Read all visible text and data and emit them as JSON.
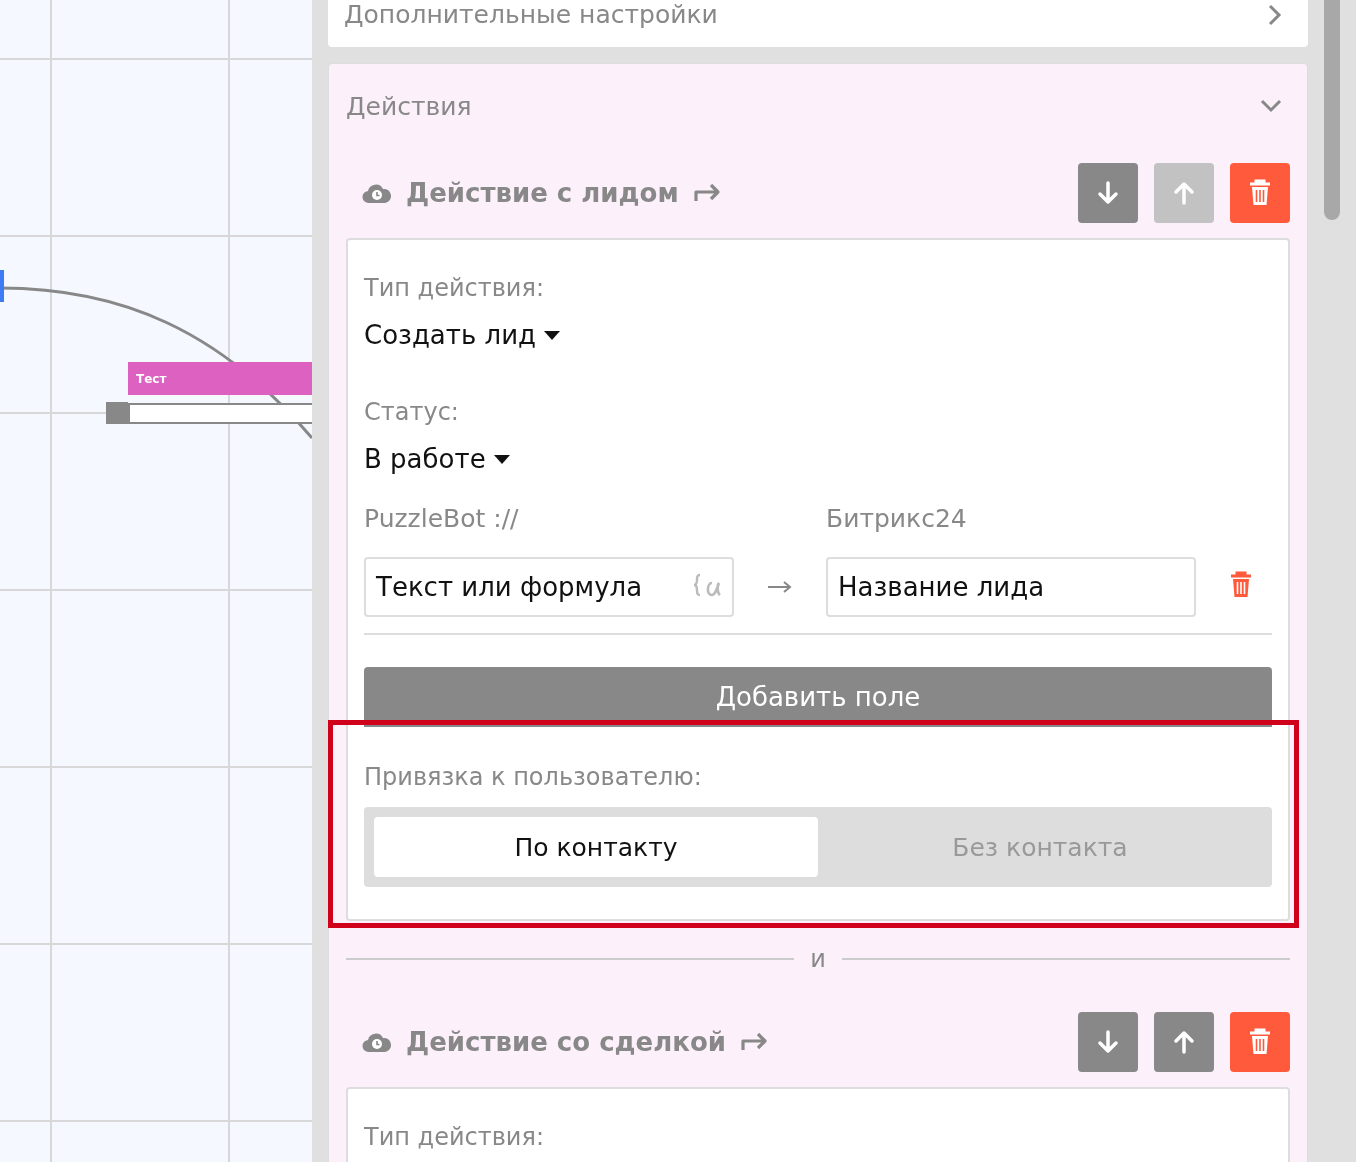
{
  "canvas": {
    "node": {
      "title": "Тест"
    }
  },
  "settings_row": {
    "label": "Дополнительные настройки"
  },
  "actions": {
    "title": "Действия",
    "expanded": true,
    "items": [
      {
        "title": "Действие с лидом",
        "down_disabled": false,
        "up_disabled": true,
        "type_label": "Тип действия:",
        "type_value": "Создать лид",
        "status_label": "Статус:",
        "status_value": "В работе",
        "mapping": {
          "left_heading": "PuzzleBot ://",
          "right_heading": "Битрикс24",
          "rows": [
            {
              "source": "Текст или формула",
              "target": "Название лида"
            }
          ]
        },
        "add_button": "Добавить поле",
        "binding": {
          "label": "Привязка к пользователю:",
          "highlighted": true,
          "options": [
            {
              "label": "По контакту",
              "selected": true
            },
            {
              "label": "Без контакта",
              "selected": false
            }
          ]
        }
      },
      {
        "title": "Действие со сделкой",
        "down_disabled": false,
        "up_disabled": false,
        "type_label": "Тип действия:"
      }
    ],
    "separator": "и"
  }
}
